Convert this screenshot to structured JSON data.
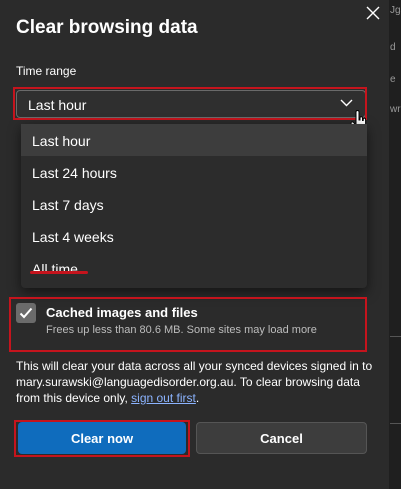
{
  "dialog": {
    "title": "Clear browsing data",
    "time_range_label": "Time range",
    "time_range_selected": "Last hour",
    "time_range_options": [
      "Last hour",
      "Last 24 hours",
      "Last 7 days",
      "Last 4 weeks",
      "All time"
    ],
    "cached": {
      "label": "Cached images and files",
      "description": "Frees up less than 80.6 MB. Some sites may load more",
      "checked": true
    },
    "info": {
      "text_before": "This will clear your data across all your synced devices signed in to mary.surawski@languagedisorder.org.au. To clear browsing data from this device only, ",
      "link": "sign out first",
      "text_after": "."
    },
    "buttons": {
      "clear": "Clear now",
      "cancel": "Cancel"
    }
  },
  "background_edge_text": [
    "Jgs",
    "d",
    "e",
    "wr"
  ],
  "colors": {
    "accent": "#0f6cbd",
    "annotation": "#c5141d",
    "dialog_bg": "#2b2b2b"
  },
  "icons": {
    "close": "close-icon",
    "chevron": "chevron-down-icon",
    "checkbox": "checkmark-icon",
    "cursor": "hand-cursor-icon"
  }
}
